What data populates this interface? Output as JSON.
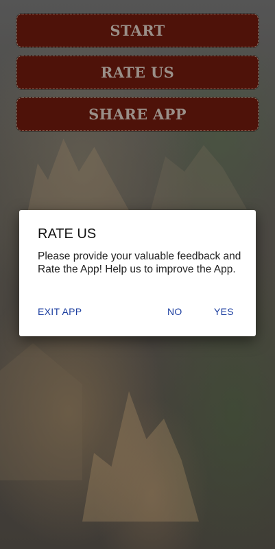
{
  "menu": {
    "start_label": "START",
    "rate_label": "RATE US",
    "share_label": "SHARE APP"
  },
  "dialog": {
    "title": "RATE US",
    "message": "Please provide your valuable feedback and Rate the App! Help us to improve the App.",
    "exit_label": "EXIT APP",
    "no_label": "NO",
    "yes_label": "YES"
  },
  "colors": {
    "button_bg": "#4e1209",
    "button_text": "#9a8f88",
    "action_text": "#1d3fa0"
  }
}
